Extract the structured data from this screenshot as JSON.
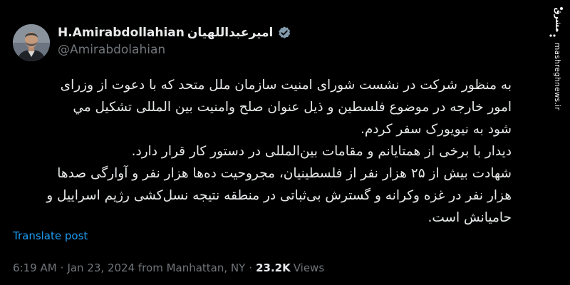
{
  "author": {
    "display_name_latin": "H.Amirabdollahian",
    "display_name_persian": "امیرعبداللهیان",
    "handle": "@Amirabdolahian",
    "avatar_icon": "profile-photo",
    "verified_color": "#829aab"
  },
  "tweet": {
    "lines": [
      "به منظور شرکت در نشست شورای امنیت سازمان ملل متحد که با دعوت از وزرای",
      "امور خارجه در موضوع فلسطین و ذیل عنوان صلح وامنیت بین المللی تشکیل مي",
      "شود  به نیویورک سفر کردم.",
      "دیدار با برخی از همتایانم و مقامات بین‌المللی در دستور کار قرار دارد.",
      "شهادت بیش از ۲۵ هزار نفر از فلسطینیان، مجروحیت ده‌ها هزار نفر و آوارگی صدها",
      "هزار نفر در غزه وکرانه و گسترش بی‌ثباتی در منطقه نتیجه نسل‌کشی رژیم اسراییل و",
      "حامیانش است."
    ],
    "translate_label": "Translate post"
  },
  "meta": {
    "time": "6:19 AM",
    "separator": "·",
    "date_location": "Jan 23, 2024 from Manhattan, NY",
    "views_count": "23.2K",
    "views_label": "Views"
  },
  "watermark": {
    "logo_text": "مشرق",
    "url": "mashreghnews.ir"
  },
  "colors": {
    "background": "#000000",
    "text_primary": "#e7e9ea",
    "text_secondary": "#71767b",
    "link": "#1d9bf0"
  }
}
